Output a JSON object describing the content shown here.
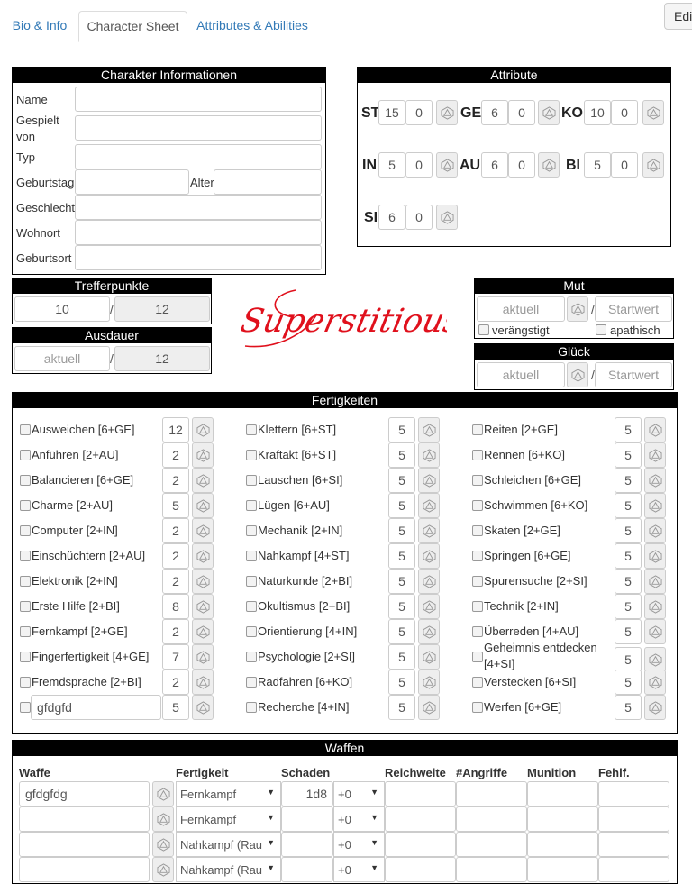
{
  "tabs": [
    {
      "label": "Bio & Info"
    },
    {
      "label": "Character Sheet"
    },
    {
      "label": "Attributes & Abilities"
    }
  ],
  "edit_button": "Edi",
  "char_info": {
    "title": "Charakter Informationen",
    "labels": {
      "name": "Name",
      "played_by": "Gespielt von",
      "type": "Typ",
      "birthday": "Geburtstag",
      "age": "Alter",
      "gender": "Geschlecht",
      "residence": "Wohnort",
      "birthplace": "Geburtsort"
    }
  },
  "attributes": {
    "title": "Attribute",
    "items": [
      {
        "abbr": "ST",
        "value": "15",
        "mod": "0"
      },
      {
        "abbr": "GE",
        "value": "6",
        "mod": "0"
      },
      {
        "abbr": "KO",
        "value": "10",
        "mod": "0"
      },
      {
        "abbr": "IN",
        "value": "5",
        "mod": "0"
      },
      {
        "abbr": "AU",
        "value": "6",
        "mod": "0"
      },
      {
        "abbr": "BI",
        "value": "5",
        "mod": "0"
      },
      {
        "abbr": "SI",
        "value": "6",
        "mod": "0"
      }
    ]
  },
  "hitpoints": {
    "title": "Trefferpunkte",
    "current": "10",
    "max": "12",
    "sep": "/"
  },
  "endurance": {
    "title": "Ausdauer",
    "current_placeholder": "aktuell",
    "max": "12",
    "sep": "/"
  },
  "logo": {
    "text": "Superstitious",
    "color": "#e0101c"
  },
  "courage": {
    "title": "Mut",
    "current_placeholder": "aktuell",
    "start_placeholder": "Startwert",
    "sep": "/",
    "check_scared": "verängstigt",
    "check_apathetic": "apathisch"
  },
  "luck": {
    "title": "Glück",
    "current_placeholder": "aktuell",
    "start_placeholder": "Startwert",
    "sep": "/"
  },
  "skills": {
    "title": "Fertigkeiten",
    "columns": [
      [
        {
          "label": "Ausweichen [6+GE]",
          "value": "12"
        },
        {
          "label": "Anführen [2+AU]",
          "value": "2"
        },
        {
          "label": "Balancieren [6+GE]",
          "value": "2"
        },
        {
          "label": "Charme [2+AU]",
          "value": "5"
        },
        {
          "label": "Computer [2+IN]",
          "value": "2"
        },
        {
          "label": "Einschüchtern [2+AU]",
          "value": "2"
        },
        {
          "label": "Elektronik [2+IN]",
          "value": "2"
        },
        {
          "label": "Erste Hilfe [2+BI]",
          "value": "8"
        },
        {
          "label": "Fernkampf [2+GE]",
          "value": "2"
        },
        {
          "label": "Fingerfertigkeit [4+GE]",
          "value": "7"
        },
        {
          "label": "Fremdsprache [2+BI]",
          "value": "2"
        }
      ],
      [
        {
          "label": "Klettern [6+ST]",
          "value": "5"
        },
        {
          "label": "Kraftakt [6+ST]",
          "value": "5"
        },
        {
          "label": "Lauschen [6+SI]",
          "value": "5"
        },
        {
          "label": "Lügen [6+AU]",
          "value": "5"
        },
        {
          "label": "Mechanik [2+IN]",
          "value": "5"
        },
        {
          "label": "Nahkampf [4+ST]",
          "value": "5"
        },
        {
          "label": "Naturkunde [2+BI]",
          "value": "5"
        },
        {
          "label": "Okultismus [2+BI]",
          "value": "5"
        },
        {
          "label": "Orientierung [4+IN]",
          "value": "5"
        },
        {
          "label": "Psychologie [2+SI]",
          "value": "5"
        },
        {
          "label": "Radfahren [6+KO]",
          "value": "5"
        },
        {
          "label": "Recherche [4+IN]",
          "value": "5"
        }
      ],
      [
        {
          "label": "Reiten [2+GE]",
          "value": "5"
        },
        {
          "label": "Rennen [6+KO]",
          "value": "5"
        },
        {
          "label": "Schleichen [6+GE]",
          "value": "5"
        },
        {
          "label": "Schwimmen [6+KO]",
          "value": "5"
        },
        {
          "label": "Skaten [2+GE]",
          "value": "5"
        },
        {
          "label": "Springen [6+GE]",
          "value": "5"
        },
        {
          "label": "Spurensuche [2+SI]",
          "value": "5"
        },
        {
          "label": "Technik [2+IN]",
          "value": "5"
        },
        {
          "label": "Überreden [4+AU]",
          "value": "5"
        },
        {
          "label": "Geheimnis entdecken [4+SI]",
          "value": "5"
        },
        {
          "label": "Verstecken [6+SI]",
          "value": "5"
        },
        {
          "label": "Werfen [6+GE]",
          "value": "5"
        }
      ]
    ],
    "custom": {
      "name": "gfdgfd",
      "value": "5"
    }
  },
  "weapons": {
    "title": "Waffen",
    "headers": {
      "weapon": "Waffe",
      "skill": "Fertigkeit",
      "damage": "Schaden",
      "range": "Reichweite",
      "attacks": "#Angriffe",
      "ammo": "Munition",
      "malfunction": "Fehlf."
    },
    "rows": [
      {
        "name": "gfdgfdg",
        "skill": "Fernkampf",
        "damage": "1d8",
        "bonus": "+0"
      },
      {
        "name": "",
        "skill": "Fernkampf",
        "damage": "",
        "bonus": "+0"
      },
      {
        "name": "",
        "skill": "Nahkampf (Rau",
        "damage": "",
        "bonus": "+0"
      },
      {
        "name": "",
        "skill": "Nahkampf (Rau",
        "damage": "",
        "bonus": "+0"
      }
    ]
  }
}
